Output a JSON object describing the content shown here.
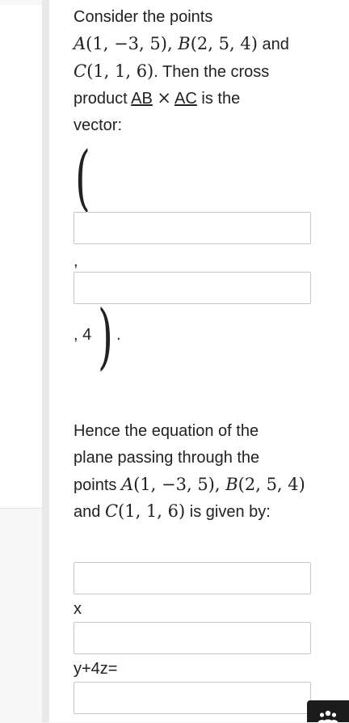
{
  "question": {
    "intro_text": "Consider the points",
    "point_a": "A(1, −3, 5)",
    "point_b": "B(2, 5, 4)",
    "and_word": "and",
    "point_c": "C(1, 1, 6)",
    "then_text": ". Then the cross",
    "product_word": "product",
    "vec_ab": "AB",
    "cross_symbol": "×",
    "vec_ac": "AC",
    "is_the": "is the",
    "vector_word": "vector:",
    "open_paren": "(",
    "comma_1": ",",
    "comma_2_value": ", 4",
    "close_paren": ")",
    "period": ".",
    "plane_text_1": "Hence the equation of the",
    "plane_text_2": "plane passing through the",
    "points_word": "points",
    "given_by": "is given by:",
    "label_x": "x",
    "label_y": "y+4z="
  },
  "inputs": {
    "vector_x_value": "",
    "vector_y_value": "",
    "plane_coef_1_value": "",
    "plane_coef_2_value": "",
    "plane_rhs_value": ""
  },
  "icons": {
    "fab": "group-people-icon"
  },
  "colors": {
    "accent": "#1f5fa8",
    "fab_bg": "#1b1b1b"
  }
}
